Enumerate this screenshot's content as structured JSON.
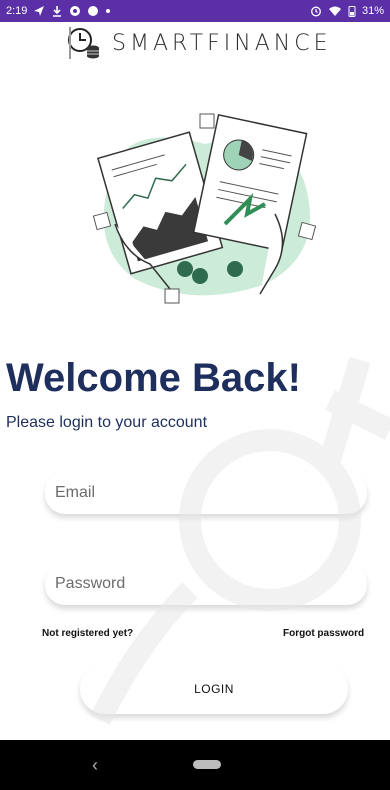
{
  "status": {
    "time": "2:19",
    "battery": "31%"
  },
  "brand": {
    "name": "SMARTFINANCE",
    "logo_icon": "coins-clock-logo"
  },
  "heading": "Welcome Back!",
  "subheading": "Please login to your account",
  "form": {
    "email_placeholder": "Email",
    "password_placeholder": "Password",
    "not_registered": "Not registered yet?",
    "forgot_password": "Forgot password",
    "login_label": "LOGIN"
  },
  "nav": {
    "back": "‹"
  },
  "colors": {
    "status_bar": "#5b2fa6",
    "heading": "#1e2f5e"
  }
}
